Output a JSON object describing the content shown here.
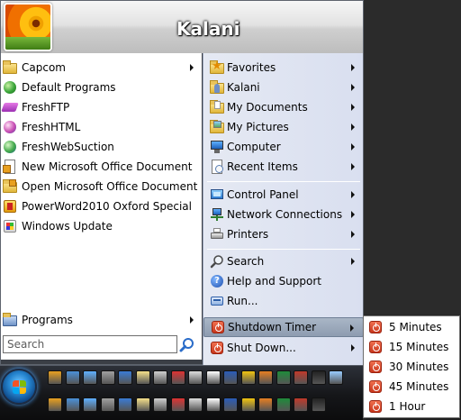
{
  "user": {
    "name": "Kalani"
  },
  "left_menu": {
    "items": [
      {
        "label": "Capcom",
        "icon": "folder-icon",
        "has_submenu": true
      },
      {
        "label": "Default Programs",
        "icon": "default-programs-icon",
        "has_submenu": false
      },
      {
        "label": "FreshFTP",
        "icon": "freshftp-icon",
        "has_submenu": false
      },
      {
        "label": "FreshHTML",
        "icon": "freshhtml-icon",
        "has_submenu": false
      },
      {
        "label": "FreshWebSuction",
        "icon": "freshwebsuction-icon",
        "has_submenu": false
      },
      {
        "label": "New Microsoft Office Document",
        "icon": "new-office-document-icon",
        "has_submenu": false
      },
      {
        "label": "Open Microsoft Office Document",
        "icon": "open-office-document-icon",
        "has_submenu": false
      },
      {
        "label": "PowerWord2010 Oxford Special",
        "icon": "powerword-icon",
        "has_submenu": false
      },
      {
        "label": "Windows Update",
        "icon": "windows-update-icon",
        "has_submenu": false
      }
    ],
    "programs_label": "Programs",
    "search_placeholder": "Search"
  },
  "right_menu": {
    "items": [
      {
        "label": "Favorites",
        "icon": "favorites-star-icon",
        "has_submenu": true
      },
      {
        "label": "Kalani",
        "icon": "user-folder-icon",
        "has_submenu": true
      },
      {
        "label": "My Documents",
        "icon": "documents-folder-icon",
        "has_submenu": true
      },
      {
        "label": "My Pictures",
        "icon": "pictures-folder-icon",
        "has_submenu": true
      },
      {
        "label": "Computer",
        "icon": "computer-icon",
        "has_submenu": true
      },
      {
        "label": "Recent Items",
        "icon": "recent-items-icon",
        "has_submenu": true
      },
      {
        "label": "Control Panel",
        "icon": "control-panel-icon",
        "has_submenu": true
      },
      {
        "label": "Network Connections",
        "icon": "network-connections-icon",
        "has_submenu": true
      },
      {
        "label": "Printers",
        "icon": "printer-icon",
        "has_submenu": true
      },
      {
        "label": "Search",
        "icon": "search-icon",
        "has_submenu": true
      },
      {
        "label": "Help and Support",
        "icon": "help-icon",
        "has_submenu": false
      },
      {
        "label": "Run...",
        "icon": "run-icon",
        "has_submenu": false
      },
      {
        "label": "Shutdown Timer",
        "icon": "shutdown-timer-icon",
        "has_submenu": true,
        "highlighted": true
      },
      {
        "label": "Shut Down...",
        "icon": "shut-down-icon",
        "has_submenu": true
      }
    ]
  },
  "shutdown_timer_submenu": {
    "items": [
      "5 Minutes",
      "15 Minutes",
      "30 Minutes",
      "45 Minutes",
      "1 Hour"
    ]
  },
  "taskbar": {
    "top_row_icons": [
      "illustrator-icon",
      "monitor-icon",
      "window-switch-icon",
      "usb-icon",
      "messenger-icon",
      "notepad-icon",
      "calculator-icon",
      "paint-icon",
      "clock-icon",
      "word-processor-icon",
      "word-icon",
      "mail-icon",
      "link-icon",
      "excel-icon",
      "game-icon",
      "penguin-icon",
      "magnifier-icon"
    ],
    "bottom_row_icons": [
      "pdf-icon",
      "acrobat-icon",
      "shutdown-app-icon",
      "text-icon",
      "smiley-icon",
      "media-icon",
      "photoshop-icon",
      "no-entry-icon",
      "globe-icon",
      "film-icon",
      "app-window-icon",
      "tool-icon",
      "hat-icon",
      "terminal-icon",
      "network-icon",
      "firefox-icon"
    ]
  },
  "colors": {
    "taskbar": "#151619",
    "highlight": "#9aa7ba",
    "header_text": "#ffffff"
  }
}
